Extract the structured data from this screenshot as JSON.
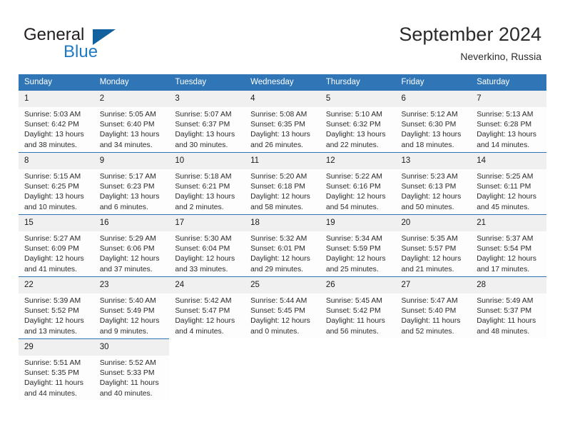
{
  "logo": {
    "word1": "General",
    "word2": "Blue",
    "triangle_color": "#12619f",
    "blue_color": "#1f7ac4"
  },
  "header": {
    "title": "September 2024",
    "location": "Neverkino, Russia"
  },
  "theme": {
    "header_bg": "#3075b5",
    "row_divider": "#2f74b4",
    "daynum_bg": "#f0f0f0",
    "cell_bg": "#fdfdfd",
    "text": "#2a2a2a"
  },
  "weekday_headers": [
    "Sunday",
    "Monday",
    "Tuesday",
    "Wednesday",
    "Thursday",
    "Friday",
    "Saturday"
  ],
  "weeks": [
    [
      {
        "day": "1",
        "sunrise": "Sunrise: 5:03 AM",
        "sunset": "Sunset: 6:42 PM",
        "daylight1": "Daylight: 13 hours",
        "daylight2": "and 38 minutes."
      },
      {
        "day": "2",
        "sunrise": "Sunrise: 5:05 AM",
        "sunset": "Sunset: 6:40 PM",
        "daylight1": "Daylight: 13 hours",
        "daylight2": "and 34 minutes."
      },
      {
        "day": "3",
        "sunrise": "Sunrise: 5:07 AM",
        "sunset": "Sunset: 6:37 PM",
        "daylight1": "Daylight: 13 hours",
        "daylight2": "and 30 minutes."
      },
      {
        "day": "4",
        "sunrise": "Sunrise: 5:08 AM",
        "sunset": "Sunset: 6:35 PM",
        "daylight1": "Daylight: 13 hours",
        "daylight2": "and 26 minutes."
      },
      {
        "day": "5",
        "sunrise": "Sunrise: 5:10 AM",
        "sunset": "Sunset: 6:32 PM",
        "daylight1": "Daylight: 13 hours",
        "daylight2": "and 22 minutes."
      },
      {
        "day": "6",
        "sunrise": "Sunrise: 5:12 AM",
        "sunset": "Sunset: 6:30 PM",
        "daylight1": "Daylight: 13 hours",
        "daylight2": "and 18 minutes."
      },
      {
        "day": "7",
        "sunrise": "Sunrise: 5:13 AM",
        "sunset": "Sunset: 6:28 PM",
        "daylight1": "Daylight: 13 hours",
        "daylight2": "and 14 minutes."
      }
    ],
    [
      {
        "day": "8",
        "sunrise": "Sunrise: 5:15 AM",
        "sunset": "Sunset: 6:25 PM",
        "daylight1": "Daylight: 13 hours",
        "daylight2": "and 10 minutes."
      },
      {
        "day": "9",
        "sunrise": "Sunrise: 5:17 AM",
        "sunset": "Sunset: 6:23 PM",
        "daylight1": "Daylight: 13 hours",
        "daylight2": "and 6 minutes."
      },
      {
        "day": "10",
        "sunrise": "Sunrise: 5:18 AM",
        "sunset": "Sunset: 6:21 PM",
        "daylight1": "Daylight: 13 hours",
        "daylight2": "and 2 minutes."
      },
      {
        "day": "11",
        "sunrise": "Sunrise: 5:20 AM",
        "sunset": "Sunset: 6:18 PM",
        "daylight1": "Daylight: 12 hours",
        "daylight2": "and 58 minutes."
      },
      {
        "day": "12",
        "sunrise": "Sunrise: 5:22 AM",
        "sunset": "Sunset: 6:16 PM",
        "daylight1": "Daylight: 12 hours",
        "daylight2": "and 54 minutes."
      },
      {
        "day": "13",
        "sunrise": "Sunrise: 5:23 AM",
        "sunset": "Sunset: 6:13 PM",
        "daylight1": "Daylight: 12 hours",
        "daylight2": "and 50 minutes."
      },
      {
        "day": "14",
        "sunrise": "Sunrise: 5:25 AM",
        "sunset": "Sunset: 6:11 PM",
        "daylight1": "Daylight: 12 hours",
        "daylight2": "and 45 minutes."
      }
    ],
    [
      {
        "day": "15",
        "sunrise": "Sunrise: 5:27 AM",
        "sunset": "Sunset: 6:09 PM",
        "daylight1": "Daylight: 12 hours",
        "daylight2": "and 41 minutes."
      },
      {
        "day": "16",
        "sunrise": "Sunrise: 5:29 AM",
        "sunset": "Sunset: 6:06 PM",
        "daylight1": "Daylight: 12 hours",
        "daylight2": "and 37 minutes."
      },
      {
        "day": "17",
        "sunrise": "Sunrise: 5:30 AM",
        "sunset": "Sunset: 6:04 PM",
        "daylight1": "Daylight: 12 hours",
        "daylight2": "and 33 minutes."
      },
      {
        "day": "18",
        "sunrise": "Sunrise: 5:32 AM",
        "sunset": "Sunset: 6:01 PM",
        "daylight1": "Daylight: 12 hours",
        "daylight2": "and 29 minutes."
      },
      {
        "day": "19",
        "sunrise": "Sunrise: 5:34 AM",
        "sunset": "Sunset: 5:59 PM",
        "daylight1": "Daylight: 12 hours",
        "daylight2": "and 25 minutes."
      },
      {
        "day": "20",
        "sunrise": "Sunrise: 5:35 AM",
        "sunset": "Sunset: 5:57 PM",
        "daylight1": "Daylight: 12 hours",
        "daylight2": "and 21 minutes."
      },
      {
        "day": "21",
        "sunrise": "Sunrise: 5:37 AM",
        "sunset": "Sunset: 5:54 PM",
        "daylight1": "Daylight: 12 hours",
        "daylight2": "and 17 minutes."
      }
    ],
    [
      {
        "day": "22",
        "sunrise": "Sunrise: 5:39 AM",
        "sunset": "Sunset: 5:52 PM",
        "daylight1": "Daylight: 12 hours",
        "daylight2": "and 13 minutes."
      },
      {
        "day": "23",
        "sunrise": "Sunrise: 5:40 AM",
        "sunset": "Sunset: 5:49 PM",
        "daylight1": "Daylight: 12 hours",
        "daylight2": "and 9 minutes."
      },
      {
        "day": "24",
        "sunrise": "Sunrise: 5:42 AM",
        "sunset": "Sunset: 5:47 PM",
        "daylight1": "Daylight: 12 hours",
        "daylight2": "and 4 minutes."
      },
      {
        "day": "25",
        "sunrise": "Sunrise: 5:44 AM",
        "sunset": "Sunset: 5:45 PM",
        "daylight1": "Daylight: 12 hours",
        "daylight2": "and 0 minutes."
      },
      {
        "day": "26",
        "sunrise": "Sunrise: 5:45 AM",
        "sunset": "Sunset: 5:42 PM",
        "daylight1": "Daylight: 11 hours",
        "daylight2": "and 56 minutes."
      },
      {
        "day": "27",
        "sunrise": "Sunrise: 5:47 AM",
        "sunset": "Sunset: 5:40 PM",
        "daylight1": "Daylight: 11 hours",
        "daylight2": "and 52 minutes."
      },
      {
        "day": "28",
        "sunrise": "Sunrise: 5:49 AM",
        "sunset": "Sunset: 5:37 PM",
        "daylight1": "Daylight: 11 hours",
        "daylight2": "and 48 minutes."
      }
    ],
    [
      {
        "day": "29",
        "sunrise": "Sunrise: 5:51 AM",
        "sunset": "Sunset: 5:35 PM",
        "daylight1": "Daylight: 11 hours",
        "daylight2": "and 44 minutes."
      },
      {
        "day": "30",
        "sunrise": "Sunrise: 5:52 AM",
        "sunset": "Sunset: 5:33 PM",
        "daylight1": "Daylight: 11 hours",
        "daylight2": "and 40 minutes."
      },
      {
        "day": "",
        "sunrise": "",
        "sunset": "",
        "daylight1": "",
        "daylight2": ""
      },
      {
        "day": "",
        "sunrise": "",
        "sunset": "",
        "daylight1": "",
        "daylight2": ""
      },
      {
        "day": "",
        "sunrise": "",
        "sunset": "",
        "daylight1": "",
        "daylight2": ""
      },
      {
        "day": "",
        "sunrise": "",
        "sunset": "",
        "daylight1": "",
        "daylight2": ""
      },
      {
        "day": "",
        "sunrise": "",
        "sunset": "",
        "daylight1": "",
        "daylight2": ""
      }
    ]
  ]
}
